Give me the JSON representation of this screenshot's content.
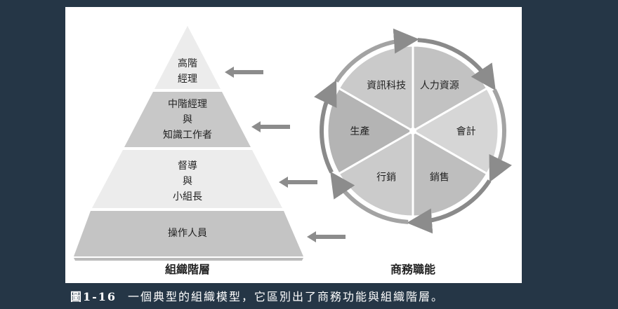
{
  "pyramid": {
    "title": "組織階層",
    "levels": [
      {
        "lines": [
          "高階",
          "經理"
        ]
      },
      {
        "lines": [
          "中階經理",
          "與",
          "知識工作者"
        ]
      },
      {
        "lines": [
          "督導",
          "與",
          "小組長"
        ]
      },
      {
        "lines": [
          "操作人員"
        ]
      }
    ]
  },
  "circle": {
    "title": "商務職能",
    "segments": [
      "資訊科技",
      "人力資源",
      "會計",
      "銷售",
      "行銷",
      "生產"
    ]
  },
  "caption": {
    "number": "圖1-16",
    "text": "一個典型的組織模型，它區別出了商務功能與組織階層。"
  },
  "colors": {
    "background": "#253646",
    "panel": "#ffffff",
    "arrow": "#8c8c8c"
  }
}
